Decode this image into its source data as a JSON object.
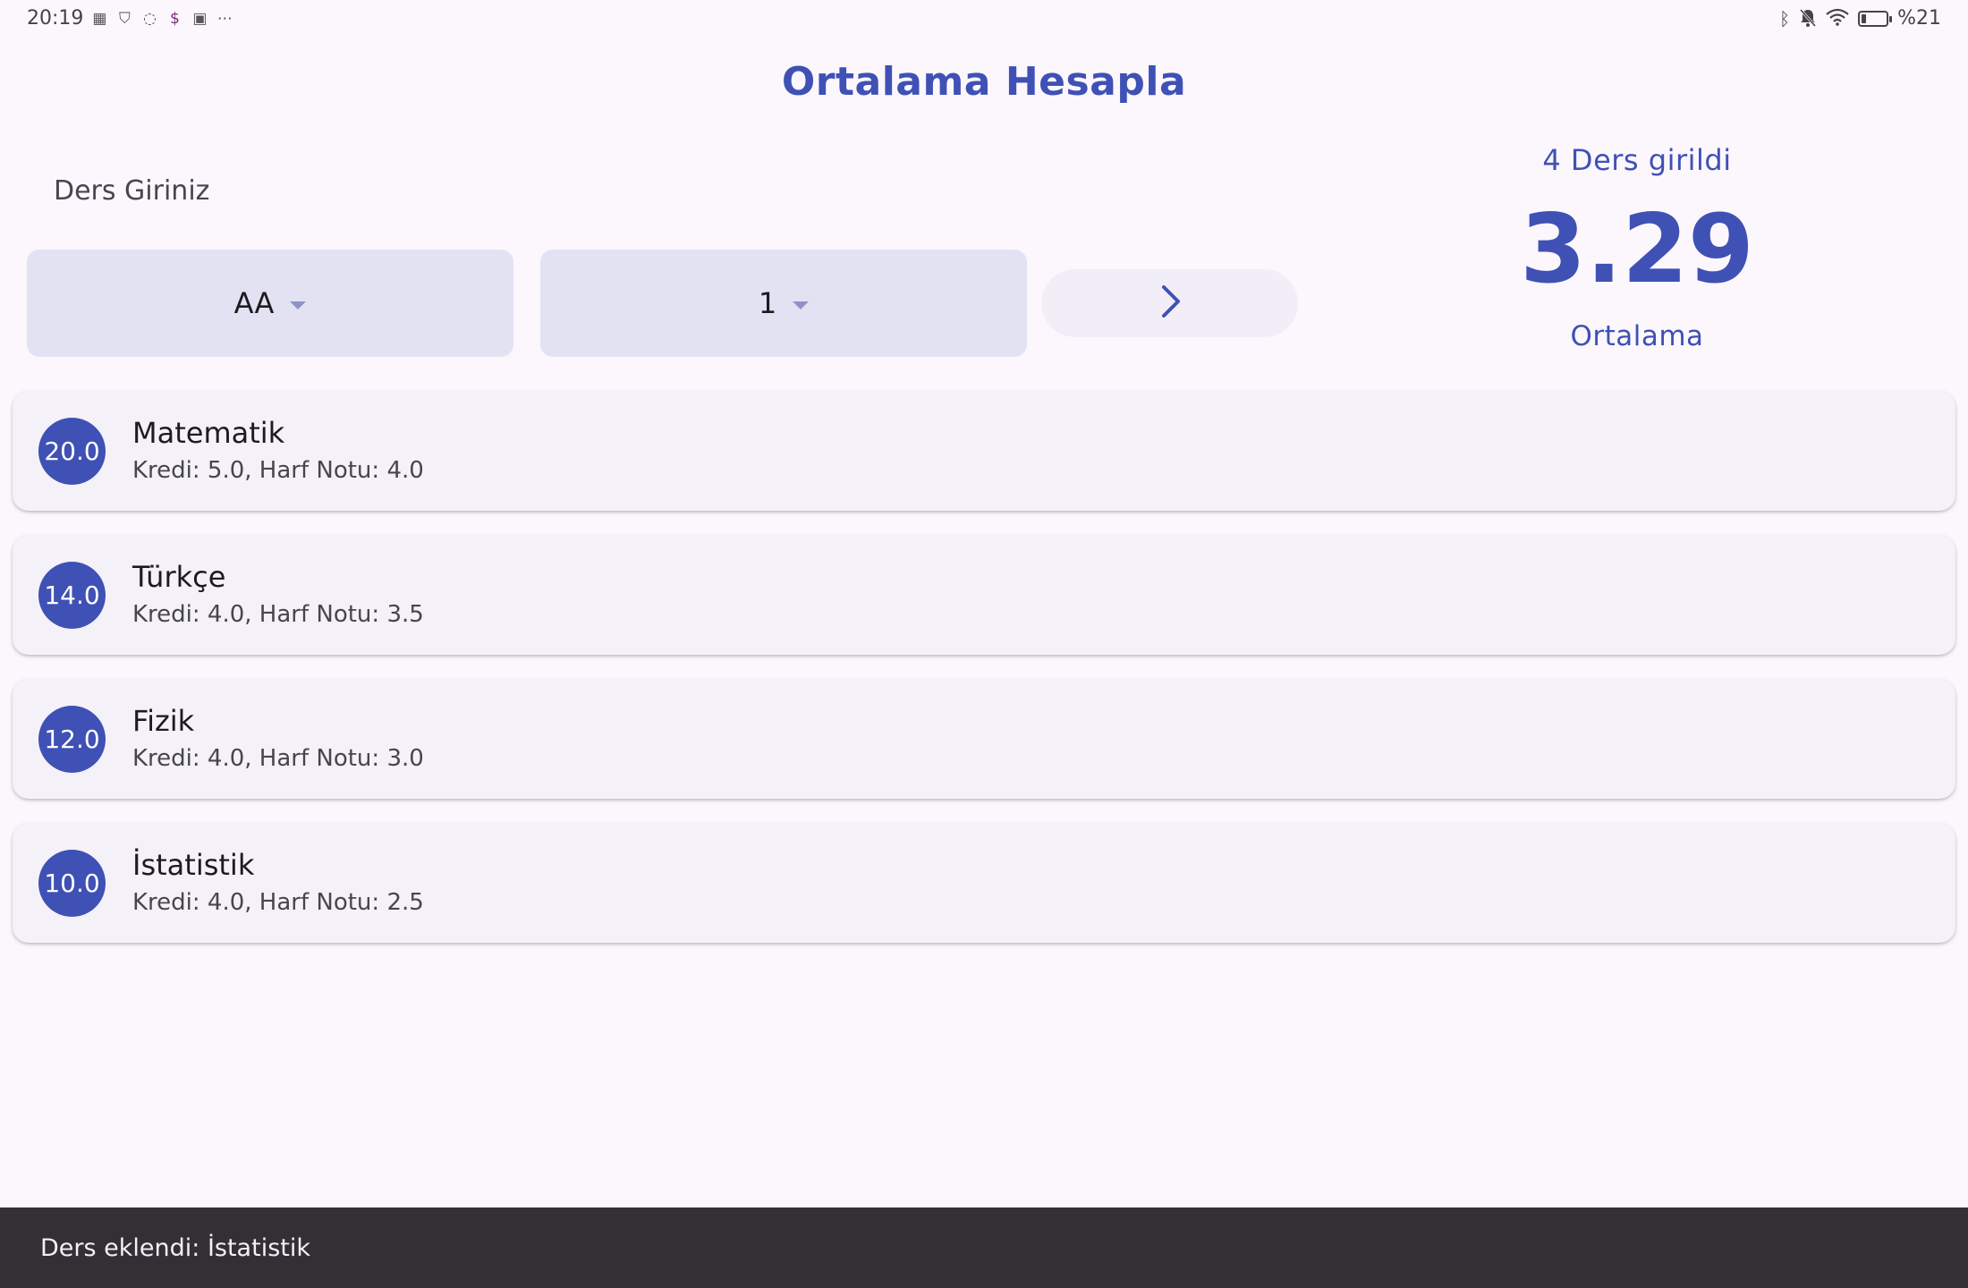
{
  "status_bar": {
    "time": "20:19",
    "battery_text": "%21",
    "battery_level": 0.21,
    "left_icons": [
      "sim-card-icon",
      "shield-check-icon",
      "whatsapp-icon",
      "dollar-app-icon",
      "tshirt-app-icon",
      "more-dots-icon"
    ],
    "right_icons": [
      "bluetooth-icon",
      "bell-off-icon",
      "wifi-icon",
      "battery-icon"
    ]
  },
  "header": {
    "title": "Ortalama Hesapla"
  },
  "form": {
    "hint": "Ders Giriniz",
    "grade_value": "AA",
    "credit_value": "1",
    "submit_icon": "chevron-right-icon"
  },
  "summary": {
    "count_text": "4 Ders girildi",
    "average": "3.29",
    "label": "Ortalama"
  },
  "courses": [
    {
      "score": "20.0",
      "name": "Matematik",
      "detail": "Kredi: 5.0, Harf Notu: 4.0"
    },
    {
      "score": "14.0",
      "name": "Türkçe",
      "detail": "Kredi: 4.0, Harf Notu: 3.5"
    },
    {
      "score": "12.0",
      "name": "Fizik",
      "detail": "Kredi: 4.0, Harf Notu: 3.0"
    },
    {
      "score": "10.0",
      "name": "İstatistik",
      "detail": "Kredi: 4.0, Harf Notu: 2.5"
    }
  ],
  "snackbar": {
    "message": "Ders eklendi: İstatistik"
  },
  "colors": {
    "primary": "#3f51b5",
    "background": "#fcf7fc",
    "dropdown_fill": "#e2e2f3",
    "card": "#f4f2f8",
    "snackbar": "#322f35"
  }
}
